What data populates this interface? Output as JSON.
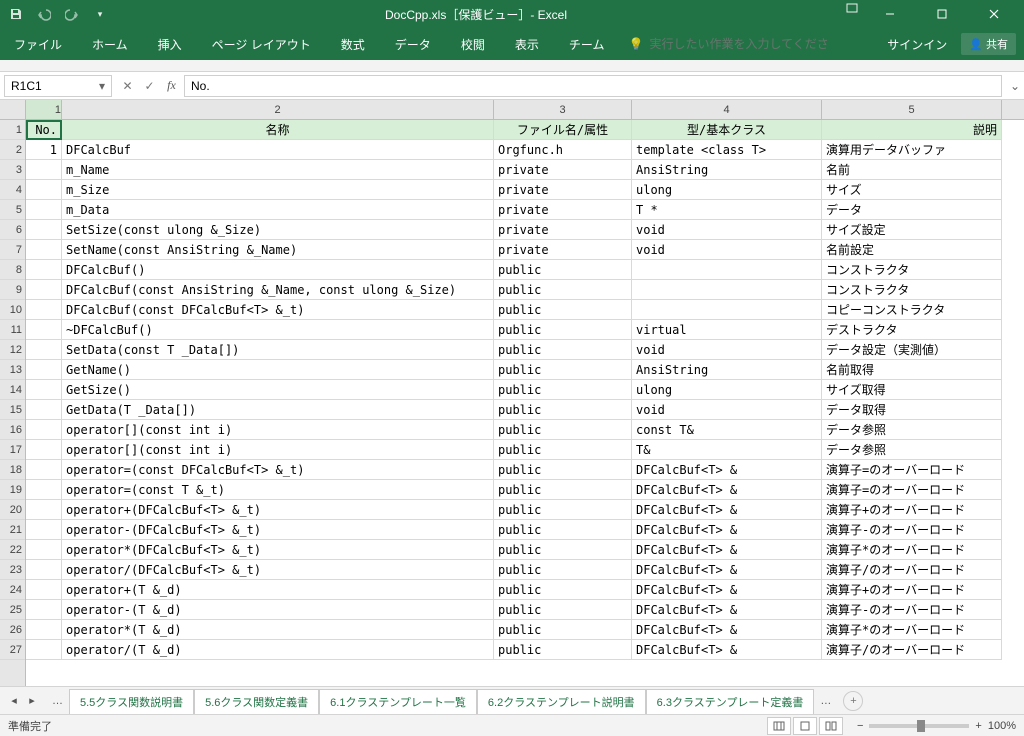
{
  "titlebar": {
    "title": "DocCpp.xls［保護ビュー］- Excel"
  },
  "ribbon": {
    "tabs": [
      "ファイル",
      "ホーム",
      "挿入",
      "ページ レイアウト",
      "数式",
      "データ",
      "校閲",
      "表示",
      "チーム"
    ],
    "tellme_placeholder": "実行したい作業を入力してください",
    "signin": "サインイン",
    "share": "共有"
  },
  "formulabar": {
    "namebox": "R1C1",
    "formula": "No."
  },
  "colheads": [
    "1",
    "2",
    "3",
    "4",
    "5"
  ],
  "header_row": [
    "No.",
    "名称",
    "ファイル名/属性",
    "型/基本クラス",
    "説明"
  ],
  "rows": [
    [
      "1",
      "DFCalcBuf",
      "Orgfunc.h",
      "template <class T>",
      "演算用データバッファ"
    ],
    [
      "",
      "m_Name",
      "private",
      "AnsiString",
      "名前"
    ],
    [
      "",
      "m_Size",
      "private",
      "ulong",
      "サイズ"
    ],
    [
      "",
      "m_Data",
      "private",
      "T *",
      "データ"
    ],
    [
      "",
      "SetSize(const ulong &_Size)",
      "private",
      "void",
      "サイズ設定"
    ],
    [
      "",
      "SetName(const AnsiString &_Name)",
      "private",
      "void",
      "名前設定"
    ],
    [
      "",
      "DFCalcBuf()",
      "public",
      "",
      "コンストラクタ"
    ],
    [
      "",
      "DFCalcBuf(const AnsiString &_Name, const ulong &_Size)",
      "public",
      "",
      "コンストラクタ"
    ],
    [
      "",
      "DFCalcBuf(const DFCalcBuf<T> &_t)",
      "public",
      "",
      "コピーコンストラクタ"
    ],
    [
      "",
      "~DFCalcBuf()",
      "public",
      "virtual",
      "デストラクタ"
    ],
    [
      "",
      "SetData(const T _Data[])",
      "public",
      "void",
      "データ設定（実測値）"
    ],
    [
      "",
      "GetName()",
      "public",
      "AnsiString",
      "名前取得"
    ],
    [
      "",
      "GetSize()",
      "public",
      "ulong",
      "サイズ取得"
    ],
    [
      "",
      "GetData(T _Data[])",
      "public",
      "void",
      "データ取得"
    ],
    [
      "",
      "operator[](const int i)",
      "public",
      "const T&",
      "データ参照"
    ],
    [
      "",
      "operator[](const int i)",
      "public",
      "T&",
      "データ参照"
    ],
    [
      "",
      "operator=(const DFCalcBuf<T> &_t)",
      "public",
      "DFCalcBuf<T> &",
      "演算子=のオーバーロード"
    ],
    [
      "",
      "operator=(const T &_t)",
      "public",
      "DFCalcBuf<T> &",
      "演算子=のオーバーロード"
    ],
    [
      "",
      "operator+(DFCalcBuf<T> &_t)",
      "public",
      "DFCalcBuf<T> &",
      "演算子+のオーバーロード"
    ],
    [
      "",
      "operator-(DFCalcBuf<T> &_t)",
      "public",
      "DFCalcBuf<T> &",
      "演算子-のオーバーロード"
    ],
    [
      "",
      "operator*(DFCalcBuf<T> &_t)",
      "public",
      "DFCalcBuf<T> &",
      "演算子*のオーバーロード"
    ],
    [
      "",
      "operator/(DFCalcBuf<T> &_t)",
      "public",
      "DFCalcBuf<T> &",
      "演算子/のオーバーロード"
    ],
    [
      "",
      "operator+(T &_d)",
      "public",
      "DFCalcBuf<T> &",
      "演算子+のオーバーロード"
    ],
    [
      "",
      "operator-(T &_d)",
      "public",
      "DFCalcBuf<T> &",
      "演算子-のオーバーロード"
    ],
    [
      "",
      "operator*(T &_d)",
      "public",
      "DFCalcBuf<T> &",
      "演算子*のオーバーロード"
    ],
    [
      "",
      "operator/(T &_d)",
      "public",
      "DFCalcBuf<T> &",
      "演算子/のオーバーロード"
    ]
  ],
  "sheettabs": {
    "tabs": [
      "5.5クラス関数説明書",
      "5.6クラス関数定義書",
      "6.1クラステンプレート一覧",
      "6.2クラステンプレート説明書",
      "6.3クラステンプレート定義書"
    ],
    "active_index": 4
  },
  "statusbar": {
    "status": "準備完了",
    "zoom": "100%"
  }
}
